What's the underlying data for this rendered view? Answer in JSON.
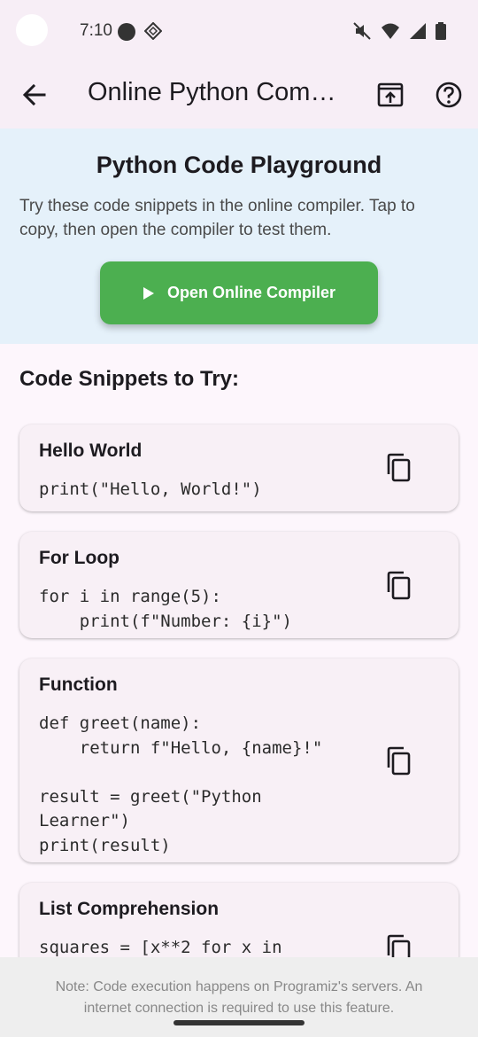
{
  "status_bar": {
    "time": "7:10",
    "icons": [
      "mute-icon",
      "wifi-icon",
      "signal-icon",
      "battery-icon"
    ]
  },
  "app_bar": {
    "title": "Online Python Compiler",
    "back_icon": "arrow-back-icon",
    "share_icon": "open-external-icon",
    "help_icon": "help-circle-icon"
  },
  "hero": {
    "title": "Python Code Playground",
    "description": "Try these code snippets in the online compiler. Tap to copy, then open the compiler to test them.",
    "open_button_label": "Open Online Compiler",
    "button_color": "#4caf50",
    "background_color": "#e5f1fa"
  },
  "snippets_section": {
    "title": "Code Snippets to Try:",
    "snippets": [
      {
        "title": "Hello World",
        "code": "print(\"Hello, World!\")"
      },
      {
        "title": "For Loop",
        "code": "for i in range(5):\n    print(f\"Number: {i}\")"
      },
      {
        "title": "Function",
        "code": "def greet(name):\n    return f\"Hello, {name}!\"\n\nresult = greet(\"Python Learner\")\nprint(result)"
      },
      {
        "title": "List Comprehension",
        "code": "squares = [x**2 for x in"
      }
    ]
  },
  "footer": {
    "note": "Note: Code execution happens on Programiz's servers. An internet connection is required to use this feature."
  }
}
